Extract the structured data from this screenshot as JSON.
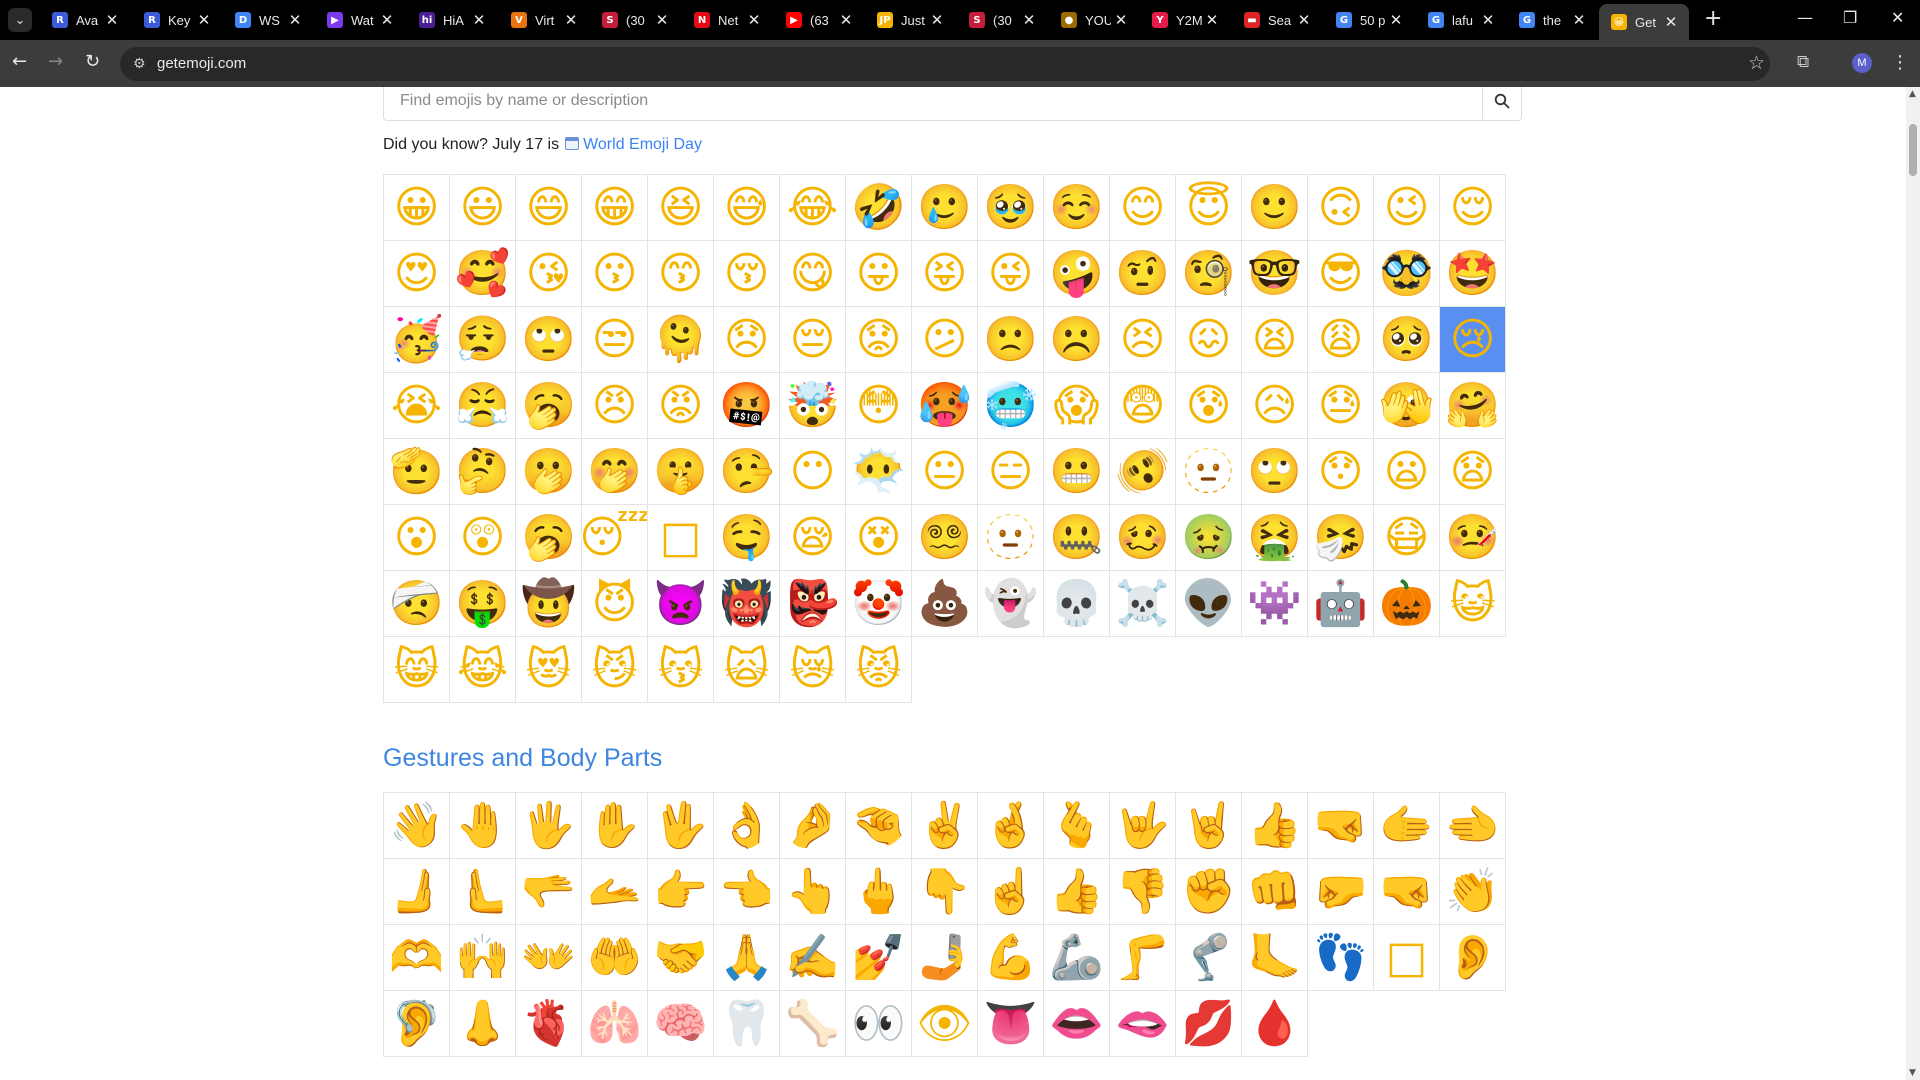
{
  "browser": {
    "tabs": [
      {
        "title": "Ava",
        "favicon": "R",
        "color": "#3b5bdb"
      },
      {
        "title": "Key",
        "favicon": "R",
        "color": "#3b5bdb"
      },
      {
        "title": "WS",
        "favicon": "D",
        "color": "#4285f4"
      },
      {
        "title": "Wat",
        "favicon": "▶",
        "color": "#7c3aed"
      },
      {
        "title": "HiA",
        "favicon": "hi",
        "color": "#4c1d95"
      },
      {
        "title": "Virt",
        "favicon": "V",
        "color": "#e9730c"
      },
      {
        "title": "(30",
        "favicon": "S",
        "color": "#c41e3a"
      },
      {
        "title": "Net",
        "favicon": "N",
        "color": "#e50914"
      },
      {
        "title": "(63",
        "favicon": "▶",
        "color": "#ff0000"
      },
      {
        "title": "Just",
        "favicon": "JP",
        "color": "#f4b400"
      },
      {
        "title": "(30",
        "favicon": "S",
        "color": "#c41e3a"
      },
      {
        "title": "YOU",
        "favicon": "●",
        "color": "#9a6a00"
      },
      {
        "title": "Y2M",
        "favicon": "Y",
        "color": "#e11d48"
      },
      {
        "title": "Sea",
        "favicon": "▬",
        "color": "#dc2626"
      },
      {
        "title": "50 p",
        "favicon": "G",
        "color": "#4285f4"
      },
      {
        "title": "lafu",
        "favicon": "G",
        "color": "#4285f4"
      },
      {
        "title": "the",
        "favicon": "G",
        "color": "#4285f4"
      },
      {
        "title": "Get",
        "favicon": "😀",
        "color": "#f5b400",
        "active": true
      }
    ],
    "url": "getemoji.com"
  },
  "search": {
    "placeholder": "Find emojis by name or description"
  },
  "did_you_know": {
    "prefix": "Did you know? July 17 is",
    "link": "World Emoji Day"
  },
  "smileys": [
    "😀",
    "😃",
    "😄",
    "😁",
    "😆",
    "😅",
    "😂",
    "🤣",
    "🥲",
    "🥹",
    "☺️",
    "😊",
    "😇",
    "🙂",
    "🙃",
    "😉",
    "😌",
    "😍",
    "🥰",
    "😘",
    "😗",
    "😙",
    "😚",
    "😋",
    "😛",
    "😝",
    "😜",
    "🤪",
    "🤨",
    "🧐",
    "🤓",
    "😎",
    "🥸",
    "🤩",
    "🥳",
    "😮‍💨",
    "🙄",
    "😒",
    "🫠",
    "😞",
    "😔",
    "😟",
    "😕",
    "🙁",
    "☹️",
    "😣",
    "😖",
    "😫",
    "😩",
    "🥺",
    "😢",
    "😭",
    "😤",
    "🥱",
    "😠",
    "😡",
    "🤬",
    "🤯",
    "😳",
    "🥵",
    "🥶",
    "😱",
    "😨",
    "😰",
    "😥",
    "😓",
    "🫣",
    "🤗",
    "🫡",
    "🤔",
    "🫢",
    "🤭",
    "🤫",
    "🤥",
    "😶",
    "😶‍🌫️",
    "😐",
    "😑",
    "😬",
    "🫨",
    "🫥",
    "🙄",
    "😯",
    "😦",
    "😧",
    "😮",
    "😲",
    "🥱",
    "😴",
    "□",
    "🤤",
    "😪",
    "😵",
    "😵‍💫",
    "🫥",
    "🤐",
    "🥴",
    "🤢",
    "🤮",
    "🤧",
    "😷",
    "🤒",
    "🤕",
    "🤑",
    "🤠",
    "😈",
    "👿",
    "👹",
    "👺",
    "🤡",
    "💩",
    "👻",
    "💀",
    "☠️",
    "👽",
    "👾",
    "🤖",
    "🎃",
    "😺",
    "😸",
    "😹",
    "😻",
    "😼",
    "😽",
    "🙀",
    "😿",
    "😾"
  ],
  "selected_index": 50,
  "section_gestures": {
    "title": "Gestures and Body Parts"
  },
  "gestures": [
    "👋",
    "🤚",
    "🖐",
    "✋",
    "🖖",
    "👌",
    "🤌",
    "🤏",
    "✌️",
    "🤞",
    "🫰",
    "🤟",
    "🤘",
    "👍",
    "🤜",
    "🫱",
    "🫲",
    "🫸",
    "🫷",
    "🫳",
    "🫴",
    "👉",
    "👈",
    "👆",
    "🖕",
    "👇",
    "☝️",
    "👍",
    "👎",
    "✊",
    "👊",
    "🤛",
    "🤜",
    "👏",
    "🫶",
    "🙌",
    "👐",
    "🤲",
    "🤝",
    "🙏",
    "✍️",
    "💅",
    "🤳",
    "💪",
    "🦾",
    "🦵",
    "🦿",
    "🦶",
    "👣",
    "□",
    "👂",
    "🦻",
    "👃",
    "🫀",
    "🫁",
    "🧠",
    "🦷",
    "🦴",
    "👀",
    "👁",
    "👅",
    "👄",
    "🫦",
    "💋",
    "🩸"
  ]
}
